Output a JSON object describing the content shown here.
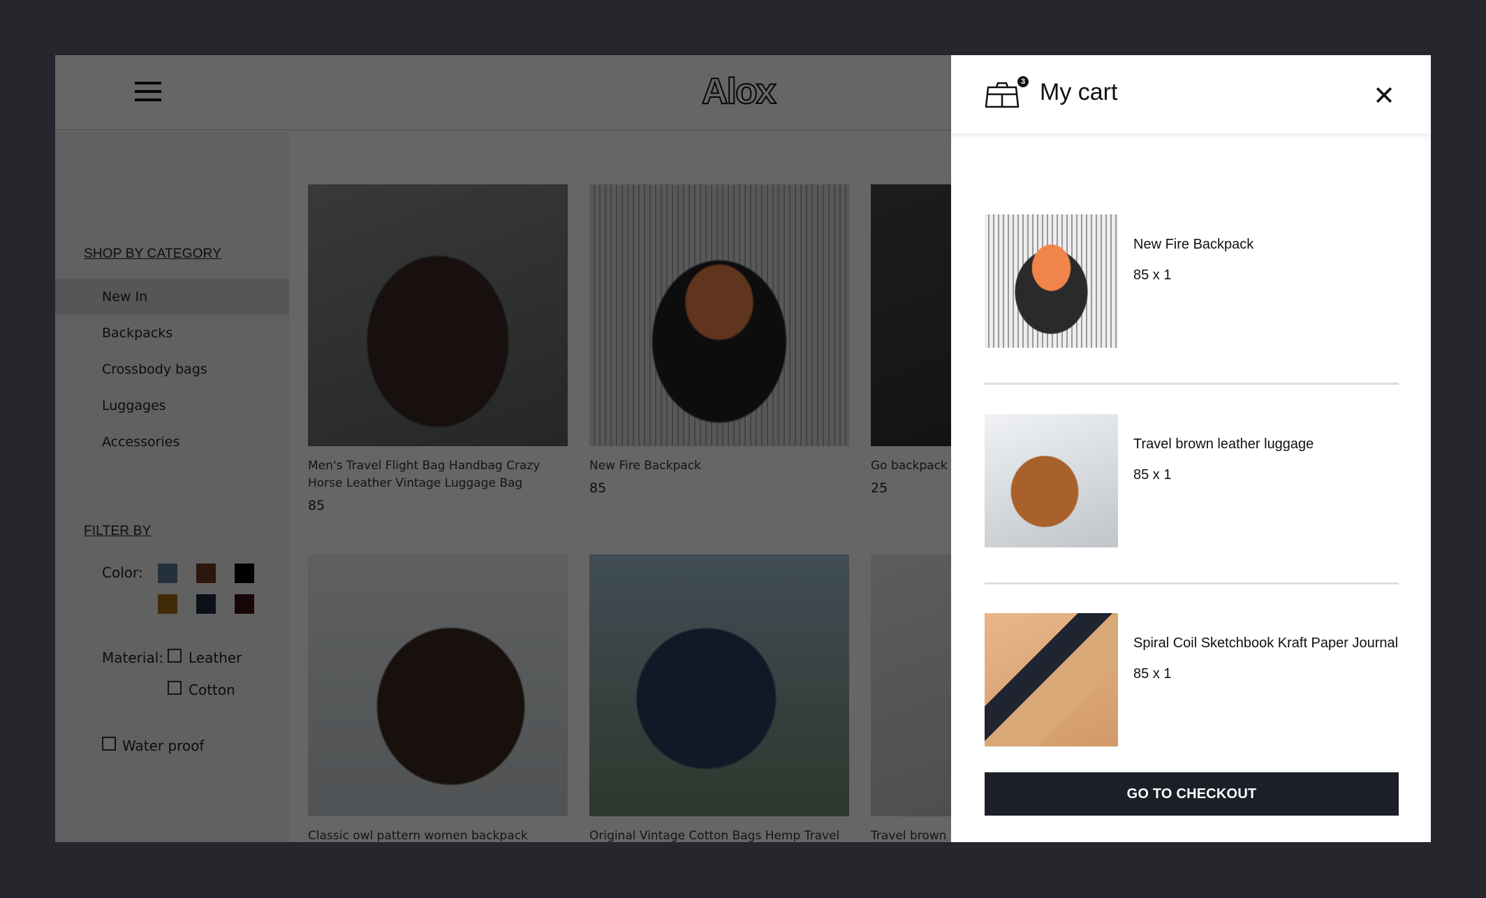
{
  "header": {
    "menu_icon": "hamburger-menu-icon",
    "logo": "Alox"
  },
  "sidebar": {
    "category_title": "SHOP BY CATEGORY",
    "categories": [
      {
        "label": "New In",
        "active": true
      },
      {
        "label": "Backpacks",
        "active": false
      },
      {
        "label": "Crossbody bags",
        "active": false
      },
      {
        "label": "Luggages",
        "active": false
      },
      {
        "label": "Accessories",
        "active": false
      }
    ],
    "filter_title": "FILTER BY",
    "color_label": "Color:",
    "colors": [
      "#5b7a99",
      "#6e3b22",
      "#000000",
      "#a46f17",
      "#1f2940",
      "#3d0e12"
    ],
    "material_label": "Material:",
    "materials": [
      {
        "label": "Leather",
        "checked": false
      },
      {
        "label": "Cotton",
        "checked": false
      }
    ],
    "waterproof": {
      "label": "Water proof",
      "checked": false
    }
  },
  "products": [
    {
      "title": "Men's Travel Flight Bag Handbag Crazy Horse Leather Vintage Luggage Bag",
      "price": "85"
    },
    {
      "title": "New Fire Backpack",
      "price": "85"
    },
    {
      "title": "Go backpack w",
      "price": "25"
    },
    {
      "title": "Classic owl pattern women backpack",
      "price": ""
    },
    {
      "title": "Original Vintage Cotton Bags Hemp Travel",
      "price": ""
    },
    {
      "title": "Travel brown le",
      "price": ""
    }
  ],
  "cart": {
    "title": "My cart",
    "count": "3",
    "icon": "shopping-bag-icon",
    "close_label": "✕",
    "items": [
      {
        "name": "New Fire Backpack",
        "qty": "85 x 1"
      },
      {
        "name": "Travel brown leather luggage",
        "qty": "85 x 1"
      },
      {
        "name": "Spiral Coil Sketchbook Kraft Paper Journal",
        "qty": "85 x 1"
      }
    ],
    "checkout_label": "GO TO CHECKOUT",
    "checkout_color": "#1b1f27"
  }
}
